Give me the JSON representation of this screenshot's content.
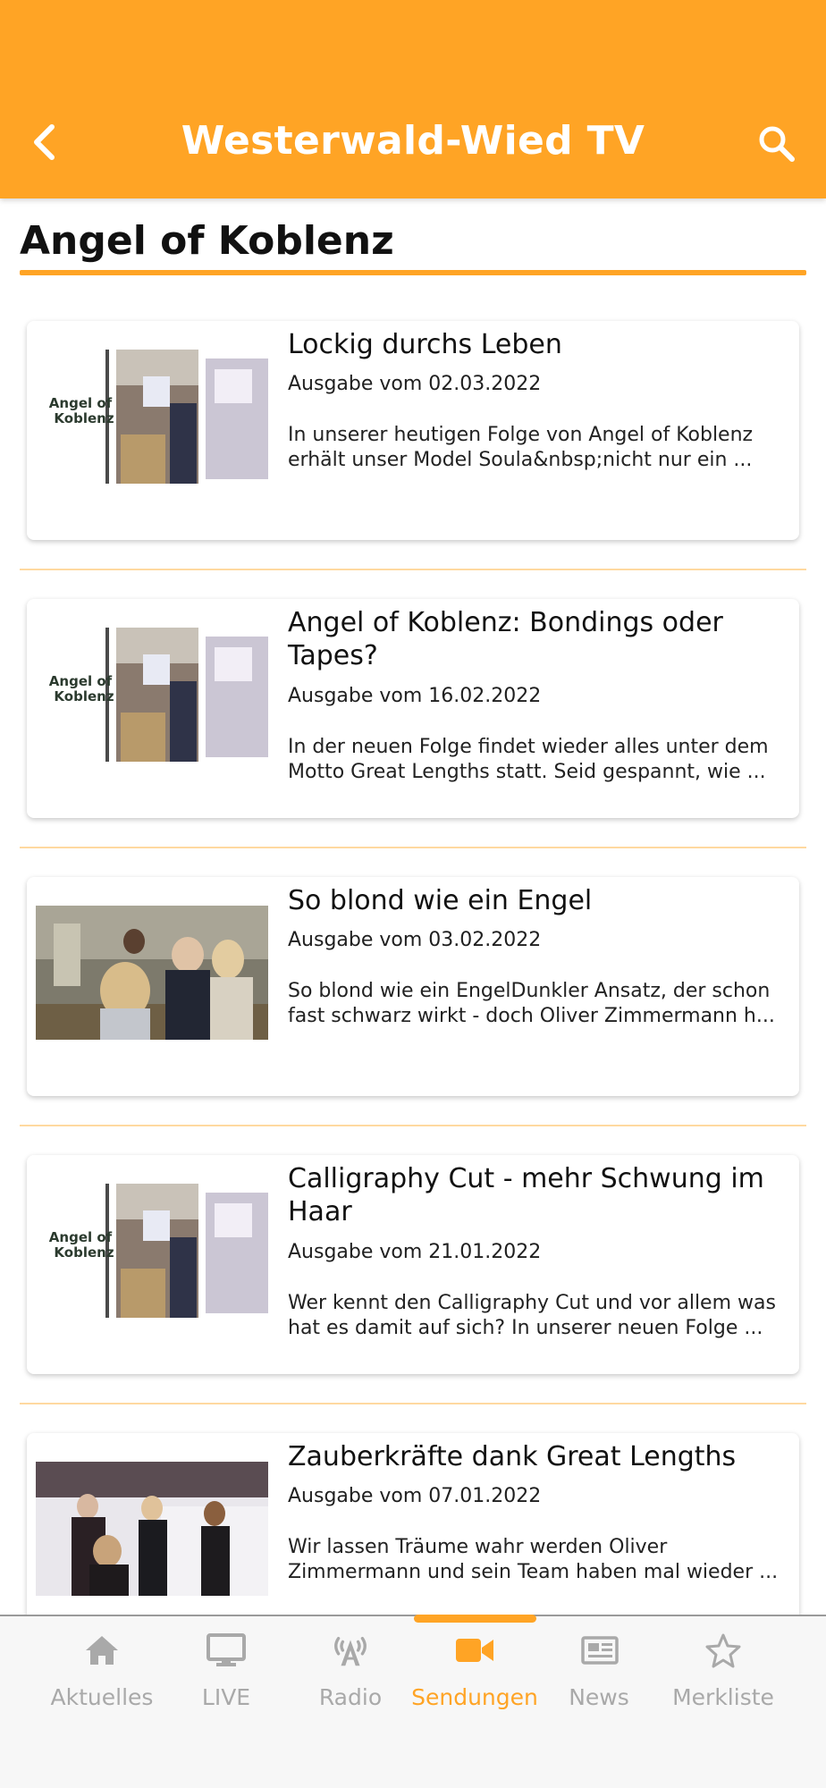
{
  "header": {
    "title": "Westerwald-Wied TV",
    "back_icon": "chevron-left-icon",
    "search_icon": "search-icon",
    "background": "#FFA425"
  },
  "section": {
    "title": "Angel of Koblenz"
  },
  "episodes": [
    {
      "title": "Lockig durchs Leben",
      "date": "Ausgabe vom 02.03.2022",
      "description": "In unserer heutigen Folge von Angel of Koblenz erhält unser Model Soula&nbsp;nicht nur ein ...",
      "thumb_type": "logo",
      "thumb_text": "Angel of Koblenz"
    },
    {
      "title": "Angel of Koblenz: Bondings oder Tapes?",
      "date": "Ausgabe vom 16.02.2022",
      "description": "In der neuen Folge findet wieder alles unter dem Motto Great Lengths statt. Seid gespannt, wie ...",
      "thumb_type": "logo",
      "thumb_text": "Angel of Koblenz"
    },
    {
      "title": "So blond wie ein Engel",
      "date": "Ausgabe vom 03.02.2022",
      "description": "So blond wie ein EngelDunkler Ansatz, der schon fast schwarz wirkt - doch Oliver Zimmermann h...",
      "thumb_type": "photo-salon"
    },
    {
      "title": "Calligraphy Cut - mehr Schwung im Haar",
      "date": "Ausgabe vom 21.01.2022",
      "description": "Wer kennt den Calligraphy Cut und vor allem was hat es damit auf sich? In unserer neuen Folge ...",
      "thumb_type": "logo",
      "thumb_text": "Angel of Koblenz"
    },
    {
      "title": "Zauberkräfte dank Great Lengths",
      "date": "Ausgabe vom 07.01.2022",
      "description": "Wir lassen Träume wahr werden Oliver Zimmermann und sein Team haben mal wieder ...",
      "thumb_type": "photo-group"
    }
  ],
  "bottom_nav": {
    "active_color": "#FFA425",
    "inactive_color": "#A9A9A9",
    "items": [
      {
        "label": "Aktuelles",
        "icon": "home-icon",
        "active": false
      },
      {
        "label": "LIVE",
        "icon": "monitor-icon",
        "active": false
      },
      {
        "label": "Radio",
        "icon": "radio-tower-icon",
        "active": false
      },
      {
        "label": "Sendungen",
        "icon": "video-camera-icon",
        "active": true
      },
      {
        "label": "News",
        "icon": "newspaper-icon",
        "active": false
      },
      {
        "label": "Merkliste",
        "icon": "star-icon",
        "active": false
      }
    ]
  }
}
